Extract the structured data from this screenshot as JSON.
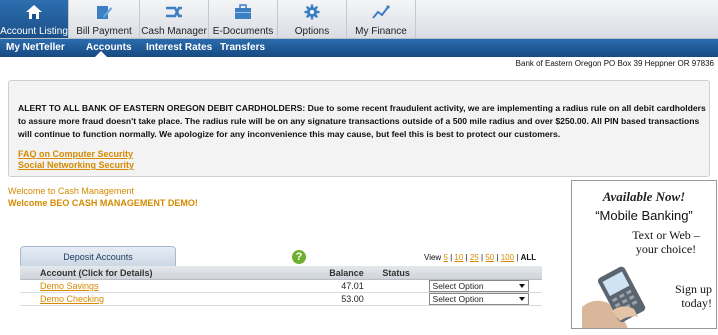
{
  "topnav": {
    "tabs": [
      {
        "label": "Account Listing",
        "icon": "home-icon"
      },
      {
        "label": "Bill Payment",
        "icon": "bill-payment-icon"
      },
      {
        "label": "Cash Manager",
        "icon": "cash-manager-icon"
      },
      {
        "label": "E-Documents",
        "icon": "edocuments-icon"
      },
      {
        "label": "Options",
        "icon": "gear-icon"
      },
      {
        "label": "My Finance",
        "icon": "chart-line-icon"
      }
    ]
  },
  "subnav": {
    "items": [
      "My NetTeller",
      "Accounts",
      "Interest Rates",
      "Transfers"
    ]
  },
  "bank_address": "Bank of Eastern Oregon PO Box 39 Heppner OR 97836",
  "alert": {
    "text": "ALERT TO ALL BANK OF EASTERN OREGON DEBIT CARDHOLDERS: Due to some recent fraudulent activity, we are implementing a radius rule on all debit cardholders to assure more fraud doesn't take place. The radius rule will be on any signature transactions outside of a 500 mile radius and over $250.00. All PIN based transactions will continue to function normally. We apologize for any inconvenience this may cause, but feel this is best to protect our customers.",
    "link1": "FAQ on Computer Security",
    "link2": "Social Networking Security"
  },
  "welcome": {
    "line1": "Welcome to Cash Management",
    "line2": "Welcome BEO CASH MANAGEMENT DEMO!"
  },
  "accounts": {
    "tab_label": "Deposit Accounts",
    "help_glyph": "?",
    "view": {
      "label": "View",
      "options": [
        "5",
        "10",
        "25",
        "50",
        "100"
      ],
      "all": "ALL"
    },
    "columns": {
      "account": "Account (Click for Details)",
      "balance": "Balance",
      "status": "Status"
    },
    "rows": [
      {
        "name": "Demo Savings",
        "balance": "47.01",
        "status": "",
        "select": "Select Option"
      },
      {
        "name": "Demo Checking",
        "balance": "53.00",
        "status": "",
        "select": "Select Option"
      }
    ]
  },
  "ad": {
    "line1": "Available Now!",
    "line2": "“Mobile Banking”",
    "line3a": "Text or Web –",
    "line3b": "your choice!",
    "line4a": "Sign up",
    "line4b": "today!"
  }
}
